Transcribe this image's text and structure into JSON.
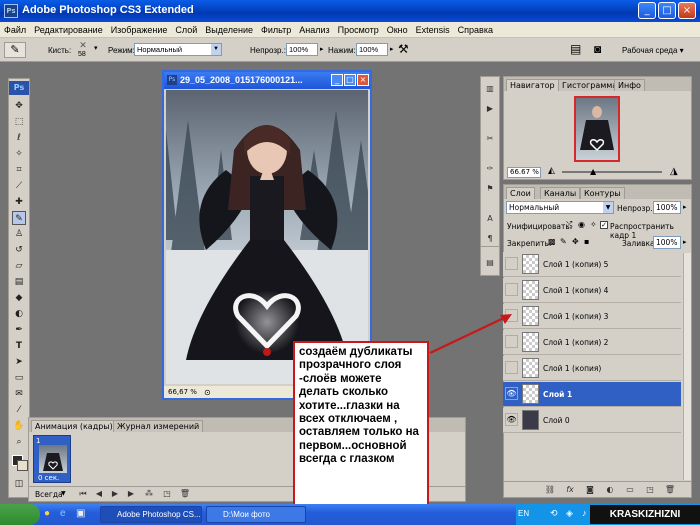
{
  "window": {
    "title": "Adobe Photoshop CS3 Extended",
    "app_badge": "Ps",
    "controls": [
      "_",
      "□",
      "×"
    ]
  },
  "menu": [
    "Файл",
    "Редактирование",
    "Изображение",
    "Слой",
    "Выделение",
    "Фильтр",
    "Анализ",
    "Просмотр",
    "Окно",
    "Extensis",
    "Справка"
  ],
  "options": {
    "brush_label": "Кисть:",
    "brush_size": "58",
    "mode_label": "Режим:",
    "mode_value": "Нормальный",
    "opacity_label": "Непрозр.:",
    "opacity_value": "100%",
    "flow_label": "Нажим:",
    "flow_value": "100%",
    "workspace": "Рабочая среда ▾"
  },
  "document": {
    "title": "29_05_2008_015176000121...",
    "zoom": "66,67 %"
  },
  "navigator": {
    "tabs": [
      "Навигатор",
      "Гистограмма",
      "Инфо"
    ],
    "zoom": "66.67 %"
  },
  "layers_panel": {
    "tabs": [
      "Слои",
      "Каналы",
      "Контуры"
    ],
    "blend_mode": "Нормальный",
    "opacity_label": "Непрозр.:",
    "opacity_value": "100%",
    "unify_label": "Унифицировать:",
    "propagate_label": "Распространить кадр 1",
    "lock_label": "Закрепить:",
    "fill_label": "Заливка:",
    "fill_value": "100%",
    "layers": [
      {
        "name": "Слой 1 (копия) 5",
        "visible": false,
        "selected": false
      },
      {
        "name": "Слой 1 (копия) 4",
        "visible": false,
        "selected": false
      },
      {
        "name": "Слой 1 (копия) 3",
        "visible": false,
        "selected": false
      },
      {
        "name": "Слой 1 (копия) 2",
        "visible": false,
        "selected": false
      },
      {
        "name": "Слой 1 (копия)",
        "visible": false,
        "selected": false
      },
      {
        "name": "Слой 1",
        "visible": true,
        "selected": true
      },
      {
        "name": "Слой 0",
        "visible": true,
        "selected": false
      }
    ]
  },
  "animation": {
    "tabs": [
      "Анимация (кадры)",
      "Журнал измерений"
    ],
    "frame_number": "1",
    "frame_delay": "0 сек.",
    "loop": "Всегда"
  },
  "annotation": "создаём дубликаты прозрачного слоя -слоёв можете делать сколько хотите...глазки на всех отключаем , оставляем только на первом...основной всегда с глазком",
  "taskbar": {
    "tasks": [
      "Adobe Photoshop CS...",
      "D:\\Мои фото"
    ],
    "lang": "EN",
    "watermark": "KRASKIZHIZNI"
  },
  "colors": {
    "accent": "#3160c4",
    "arrow": "#c81818",
    "workspace_bg": "#737373"
  }
}
